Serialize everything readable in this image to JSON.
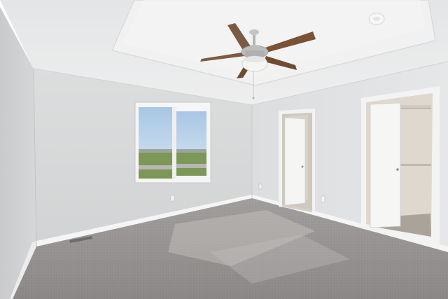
{
  "scene": {
    "subject": "empty bedroom",
    "colors": {
      "ceiling": "#e9eaea",
      "tray_ceiling": "#eeeeee",
      "back_wall": "#d9dadb",
      "left_wall": "#cfd0d1",
      "right_wall": "#e0e1e2",
      "carpet": "#8f8c8b",
      "baseboard": "#f4f4f4",
      "door": "#f3f3f2",
      "sky": "#b9d3ea",
      "grass": "#7f9a58",
      "fan_blade": "#7a5236",
      "fan_metal": "#b8b8b8"
    },
    "icons": {
      "fan": "ceiling-fan-icon",
      "detector": "smoke-detector-icon",
      "vent": "floor-vent-icon",
      "outlet": "outlet-icon"
    }
  }
}
